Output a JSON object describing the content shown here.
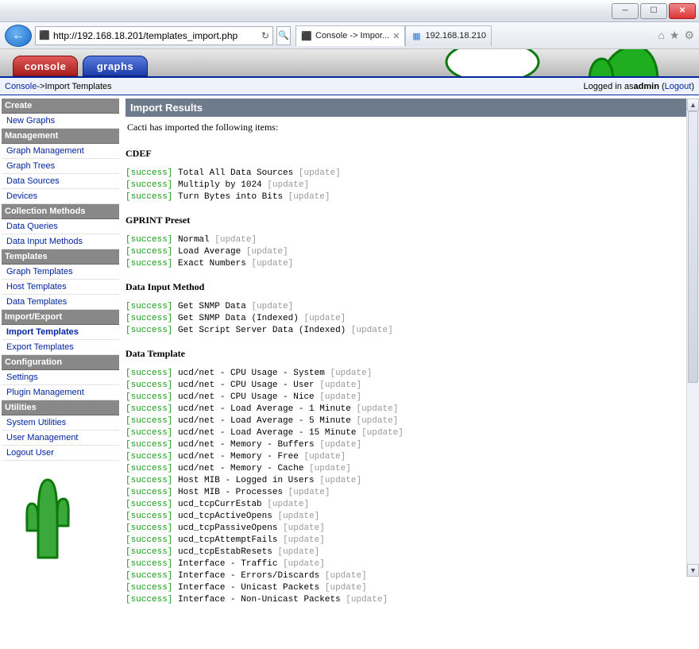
{
  "browser": {
    "url": "http://192.168.18.201/templates_import.php",
    "tab1_title": "Console -> Impor...",
    "tab2_title": "192.168.18.210",
    "refresh_tip": "↻",
    "search_icon": "🔍"
  },
  "header": {
    "tab_console": "console",
    "tab_graphs": "graphs"
  },
  "breadcrumb": {
    "console": "Console",
    "sep": " -> ",
    "current": "Import Templates",
    "logged_in": "Logged in as ",
    "user": "admin",
    "logout": "Logout"
  },
  "sidebar": {
    "sections": [
      {
        "title": "Create",
        "items": [
          "New Graphs"
        ]
      },
      {
        "title": "Management",
        "items": [
          "Graph Management",
          "Graph Trees",
          "Data Sources",
          "Devices"
        ]
      },
      {
        "title": "Collection Methods",
        "items": [
          "Data Queries",
          "Data Input Methods"
        ]
      },
      {
        "title": "Templates",
        "items": [
          "Graph Templates",
          "Host Templates",
          "Data Templates"
        ]
      },
      {
        "title": "Import/Export",
        "items": [
          "Import Templates",
          "Export Templates"
        ]
      },
      {
        "title": "Configuration",
        "items": [
          "Settings",
          "Plugin Management"
        ]
      },
      {
        "title": "Utilities",
        "items": [
          "System Utilities",
          "User Management",
          "Logout User"
        ]
      }
    ],
    "current_item": "Import Templates"
  },
  "main": {
    "title": "Import Results",
    "intro": "Cacti has imported the following items:",
    "status_label": "success",
    "update_label": "update",
    "groups": [
      {
        "heading": "CDEF",
        "items": [
          "Total All Data Sources",
          "Multiply by 1024",
          "Turn Bytes into Bits"
        ]
      },
      {
        "heading": "GPRINT Preset",
        "items": [
          "Normal",
          "Load Average",
          "Exact Numbers"
        ]
      },
      {
        "heading": "Data Input Method",
        "items": [
          "Get SNMP Data",
          "Get SNMP Data (Indexed)",
          "Get Script Server Data (Indexed)"
        ]
      },
      {
        "heading": "Data Template",
        "items": [
          "ucd/net - CPU Usage - System",
          "ucd/net - CPU Usage - User",
          "ucd/net - CPU Usage - Nice",
          "ucd/net - Load Average - 1 Minute",
          "ucd/net - Load Average - 5 Minute",
          "ucd/net - Load Average - 15 Minute",
          "ucd/net - Memory - Buffers",
          "ucd/net - Memory - Free",
          "ucd/net - Memory - Cache",
          "Host MIB - Logged in Users",
          "Host MIB - Processes",
          "ucd_tcpCurrEstab",
          "ucd_tcpActiveOpens",
          "ucd_tcpPassiveOpens",
          "ucd_tcpAttemptFails",
          "ucd_tcpEstabResets",
          "Interface - Traffic",
          "Interface - Errors/Discards",
          "Interface - Unicast Packets",
          "Interface - Non-Unicast Packets"
        ]
      }
    ]
  }
}
